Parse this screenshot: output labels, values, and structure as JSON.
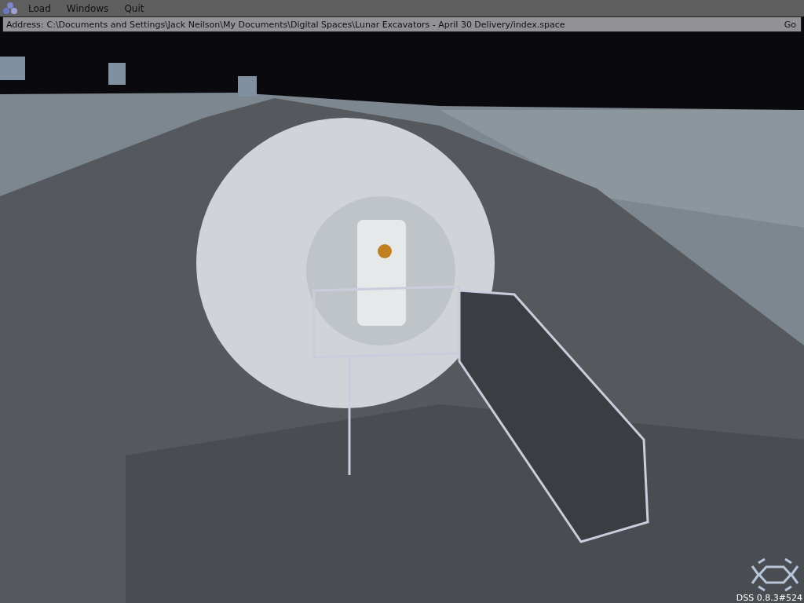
{
  "menu": [
    {
      "label": "Load"
    },
    {
      "label": "Windows"
    },
    {
      "label": "Quit"
    }
  ],
  "address_bar": {
    "label": "Address:",
    "value": "C:\\Documents and Settings\\Jack Neilson\\My Documents\\Digital Spaces\\Lunar Excavators - April 30 Delivery/index.space",
    "go": "Go"
  },
  "version": "DSS 0.8.3#524"
}
